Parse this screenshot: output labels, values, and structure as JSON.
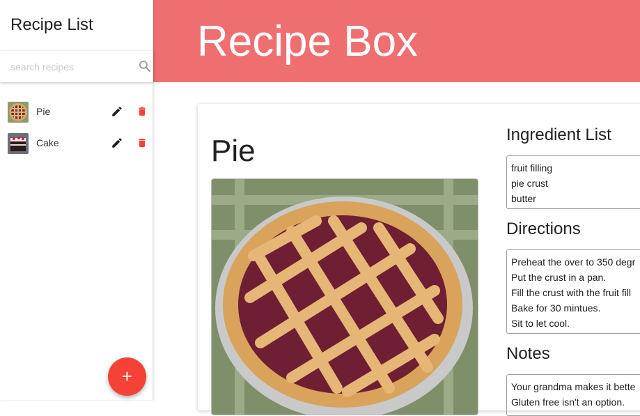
{
  "sidebar": {
    "title": "Recipe List",
    "search": {
      "placeholder": "search recipes",
      "value": ""
    },
    "items": [
      {
        "label": "Pie",
        "icon": "pie-thumbnail"
      },
      {
        "label": "Cake",
        "icon": "cake-thumbnail"
      }
    ],
    "add_button": "+"
  },
  "header": {
    "title": "Recipe Box"
  },
  "recipe": {
    "title": "Pie",
    "ingredients_heading": "Ingredient List",
    "ingredients": [
      "fruit filling",
      "pie crust",
      "butter"
    ],
    "directions_heading": "Directions",
    "directions": [
      "Preheat the over to 350 degr",
      "Put the crust in a pan.",
      "Fill the crust with the fruit fill",
      "Bake for 30 mintues.",
      "Sit to let cool."
    ],
    "notes_heading": "Notes",
    "notes": [
      "Your grandma makes it bette",
      "Gluten free isn't an option."
    ]
  },
  "colors": {
    "header": "#ef6f71",
    "accent": "#f44336",
    "delete": "#f44336"
  }
}
